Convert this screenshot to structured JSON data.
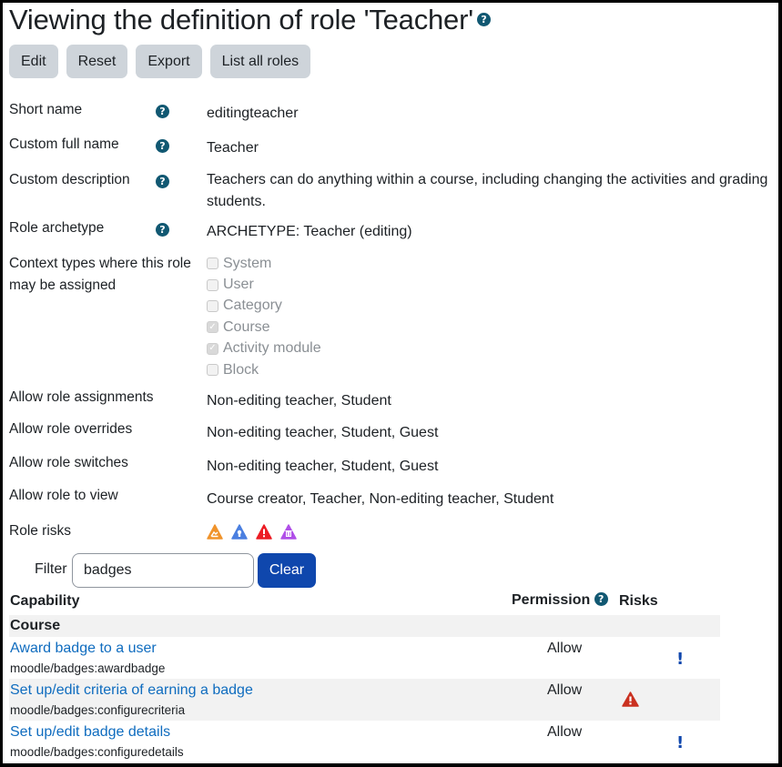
{
  "page": {
    "title": "Viewing the definition of role 'Teacher'",
    "help_icon": "question-circle-icon"
  },
  "toolbar": {
    "edit_label": "Edit",
    "reset_label": "Reset",
    "export_label": "Export",
    "list_all_label": "List all roles"
  },
  "fields": {
    "short_name": {
      "label": "Short name",
      "value": "editingteacher"
    },
    "full_name": {
      "label": "Custom full name",
      "value": "Teacher"
    },
    "description": {
      "label": "Custom description",
      "value": "Teachers can do anything within a course, including changing the activities and grading students."
    },
    "archetype": {
      "label": "Role archetype",
      "value": "ARCHETYPE: Teacher (editing)"
    },
    "context_types": {
      "label": "Context types where this role may be assigned",
      "options": [
        {
          "label": "System",
          "checked": false
        },
        {
          "label": "User",
          "checked": false
        },
        {
          "label": "Category",
          "checked": false
        },
        {
          "label": "Course",
          "checked": true
        },
        {
          "label": "Activity module",
          "checked": true
        },
        {
          "label": "Block",
          "checked": false
        }
      ]
    },
    "allow_assign": {
      "label": "Allow role assignments",
      "value": "Non-editing teacher, Student"
    },
    "allow_override": {
      "label": "Allow role overrides",
      "value": "Non-editing teacher, Student, Guest"
    },
    "allow_switch": {
      "label": "Allow role switches",
      "value": "Non-editing teacher, Student, Guest"
    },
    "allow_view": {
      "label": "Allow role to view",
      "value": "Course creator, Teacher, Non-editing teacher, Student"
    },
    "role_risks": {
      "label": "Role risks",
      "icons": [
        {
          "name": "risk-xss-icon",
          "color": "#f0932b"
        },
        {
          "name": "risk-personal-icon",
          "color": "#4a7fe0"
        },
        {
          "name": "risk-config-icon",
          "color": "#ec1c24"
        },
        {
          "name": "risk-dataloss-icon",
          "color": "#b04fe8"
        }
      ]
    }
  },
  "filter": {
    "label": "Filter",
    "value": "badges",
    "clear_label": "Clear"
  },
  "table": {
    "headers": {
      "capability": "Capability",
      "permission": "Permission",
      "risks": "Risks"
    },
    "group": "Course",
    "rows": [
      {
        "title": "Award badge to a user",
        "name": "moodle/badges:awardbadge",
        "permission": "Allow",
        "risk": "exclamation"
      },
      {
        "title": "Set up/edit criteria of earning a badge",
        "name": "moodle/badges:configurecriteria",
        "permission": "Allow",
        "risk": "warning"
      },
      {
        "title": "Set up/edit badge details",
        "name": "moodle/badges:configuredetails",
        "permission": "Allow",
        "risk": "exclamation"
      }
    ]
  },
  "colors": {
    "help": "#115872",
    "link": "#0f6cbf",
    "primary_button": "#0f47ad",
    "secondary_button": "#ced4da",
    "risk_warning": "#ca3120",
    "risk_info": "#0f47ad"
  }
}
